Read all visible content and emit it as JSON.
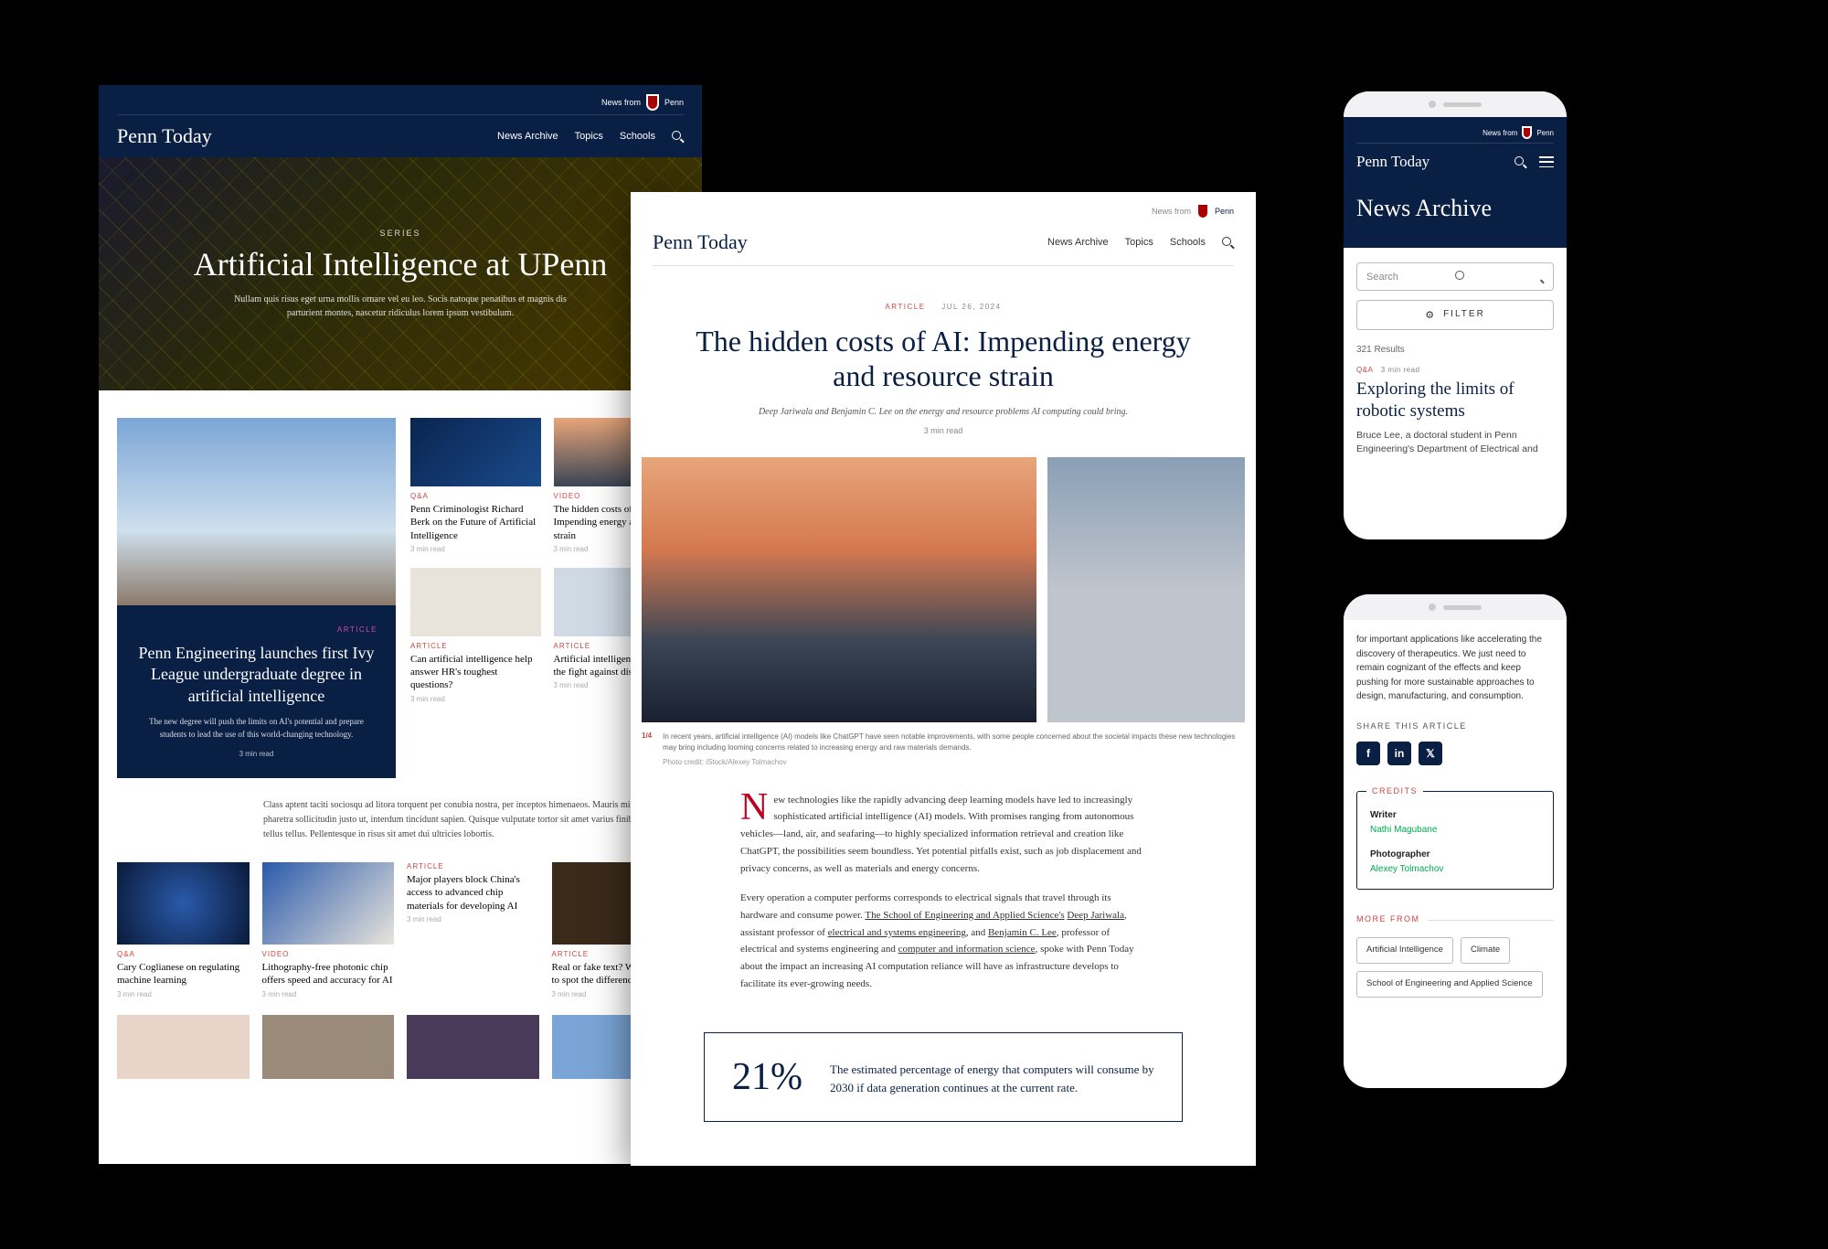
{
  "brand": "Penn Today",
  "news_from": "News from",
  "penn_logo": "Penn",
  "nav": {
    "archive": "News Archive",
    "topics": "Topics",
    "schools": "Schools"
  },
  "d1": {
    "hero": {
      "category": "SERIES",
      "title": "Artificial Intelligence at UPenn",
      "subtitle": "Nullam quis risus eget urna mollis ornare vel eu leo. Socis natoque penatibus et magnis dis parturient montes, nascetur ridiculus lorem ipsum vestibulum."
    },
    "feature": {
      "category": "ARTICLE",
      "title": "Penn Engineering launches first Ivy League undergraduate degree in artificial intelligence",
      "deck": "The new degree will push the limits on AI's potential and prepare students to lead the use of this world-changing technology.",
      "read": "3 min read"
    },
    "cards": [
      {
        "cat": "Q&A",
        "title": "Penn Criminologist Richard Berk on the Future of Artificial Intelligence",
        "read": "3 min read"
      },
      {
        "cat": "VIDEO",
        "title": "The hidden costs of AI: Impending energy and resource strain",
        "read": "3 min read"
      },
      {
        "cat": "ARTICLE",
        "title": "Can artificial intelligence help answer HR's toughest questions?",
        "read": "3 min read"
      },
      {
        "cat": "ARTICLE",
        "title": "Artificial intelligence picks up the fight against diseases",
        "read": "3 min read"
      }
    ],
    "para": "Class aptent taciti sociosqu ad litora torquent per conubia nostra, per inceptos himenaeos. Mauris mi libero, pharetra sollicitudin justo ut, interdum tincidunt sapien. Quisque vulputate tortor sit amet varius finibus. Duis quis tellus tellus. Pellentesque in risus sit amet dui ultricies lobortis.",
    "row2": [
      {
        "cat": "Q&A",
        "title": "Cary Coglianese on regulating machine learning",
        "read": "3 min read"
      },
      {
        "cat": "VIDEO",
        "title": "Lithography-free photonic chip offers speed and accuracy for AI",
        "read": "3 min read"
      },
      {
        "cat": "ARTICLE",
        "title": "Major players block China's access to advanced chip materials for developing AI",
        "read": "3 min read"
      },
      {
        "cat": "ARTICLE",
        "title": "Real or fake text? We can learn to spot the difference",
        "read": "3 min read"
      }
    ]
  },
  "d2": {
    "meta": {
      "category": "ARTICLE",
      "date": "JUL 26, 2024"
    },
    "title": "The hidden costs of AI: Impending energy and resource strain",
    "deck": "Deep Jariwala and Benjamin C. Lee on the energy and resource problems AI computing could bring.",
    "readtime": "3 min read",
    "caption": {
      "num": "1/4",
      "text": "In recent years, artificial intelligence (AI) models like ChatGPT have seen notable improvements, with some people concerned about the societal impacts these new technologies may bring including looming concerns related to increasing energy and raw materials demands.",
      "credit": "Photo credit: iStock/Alexey Tolmachov"
    },
    "body": {
      "p1_first": "N",
      "p1": "ew technologies like the rapidly advancing deep learning models have led to increasingly sophisticated artificial intelligence (AI) models. With promises ranging from autonomous vehicles—land, air, and seafaring—to highly specialized information retrieval and creation like ChatGPT, the possibilities seem boundless. Yet potential pitfalls exist, such as job displacement and privacy concerns, as well as materials and energy concerns.",
      "p2a": "Every operation a computer performs corresponds to electrical signals that travel through its hardware and consume power. ",
      "p2_link1": "The School of Engineering and Applied Science's",
      "p2b": " ",
      "p2_link2": "Deep Jariwala",
      "p2c": ", assistant professor of ",
      "p2_link3": "electrical and systems engineering",
      "p2d": ", and ",
      "p2_link4": "Benjamin C. Lee",
      "p2e": ", professor of electrical and systems engineering and ",
      "p2_link5": "computer and information science",
      "p2f": ", spoke with Penn Today about the impact an increasing AI computation reliance will have as infrastructure develops to facilitate its ever-growing needs."
    },
    "pullquote": {
      "num": "21%",
      "text": "The estimated percentage of energy that computers will consume by 2030 if data generation continues at the current rate."
    }
  },
  "m1": {
    "title": "News Archive",
    "search_placeholder": "Search",
    "filter": "FILTER",
    "results": "321 Results",
    "item": {
      "cat": "Q&A",
      "read": "3 min read",
      "title": "Exploring the limits of robotic systems",
      "deck": "Bruce Lee, a doctoral student in Penn Engineering's Department of Electrical and"
    }
  },
  "m2": {
    "snippet": "for important applications like accelerating the discovery of therapeutics. We just need to remain cognizant of the effects and keep pushing for more sustainable approaches to design, manufacturing, and consumption.",
    "share_label": "SHARE THIS ARTICLE",
    "credits_label": "CREDITS",
    "credits": [
      {
        "role": "Writer",
        "name": "Nathi Magubane"
      },
      {
        "role": "Photographer",
        "name": "Alexey Tolmachov"
      }
    ],
    "more_label": "MORE FROM",
    "tags": [
      "Artificial Intelligence",
      "Climate",
      "School of Engineering and Applied Science"
    ]
  }
}
